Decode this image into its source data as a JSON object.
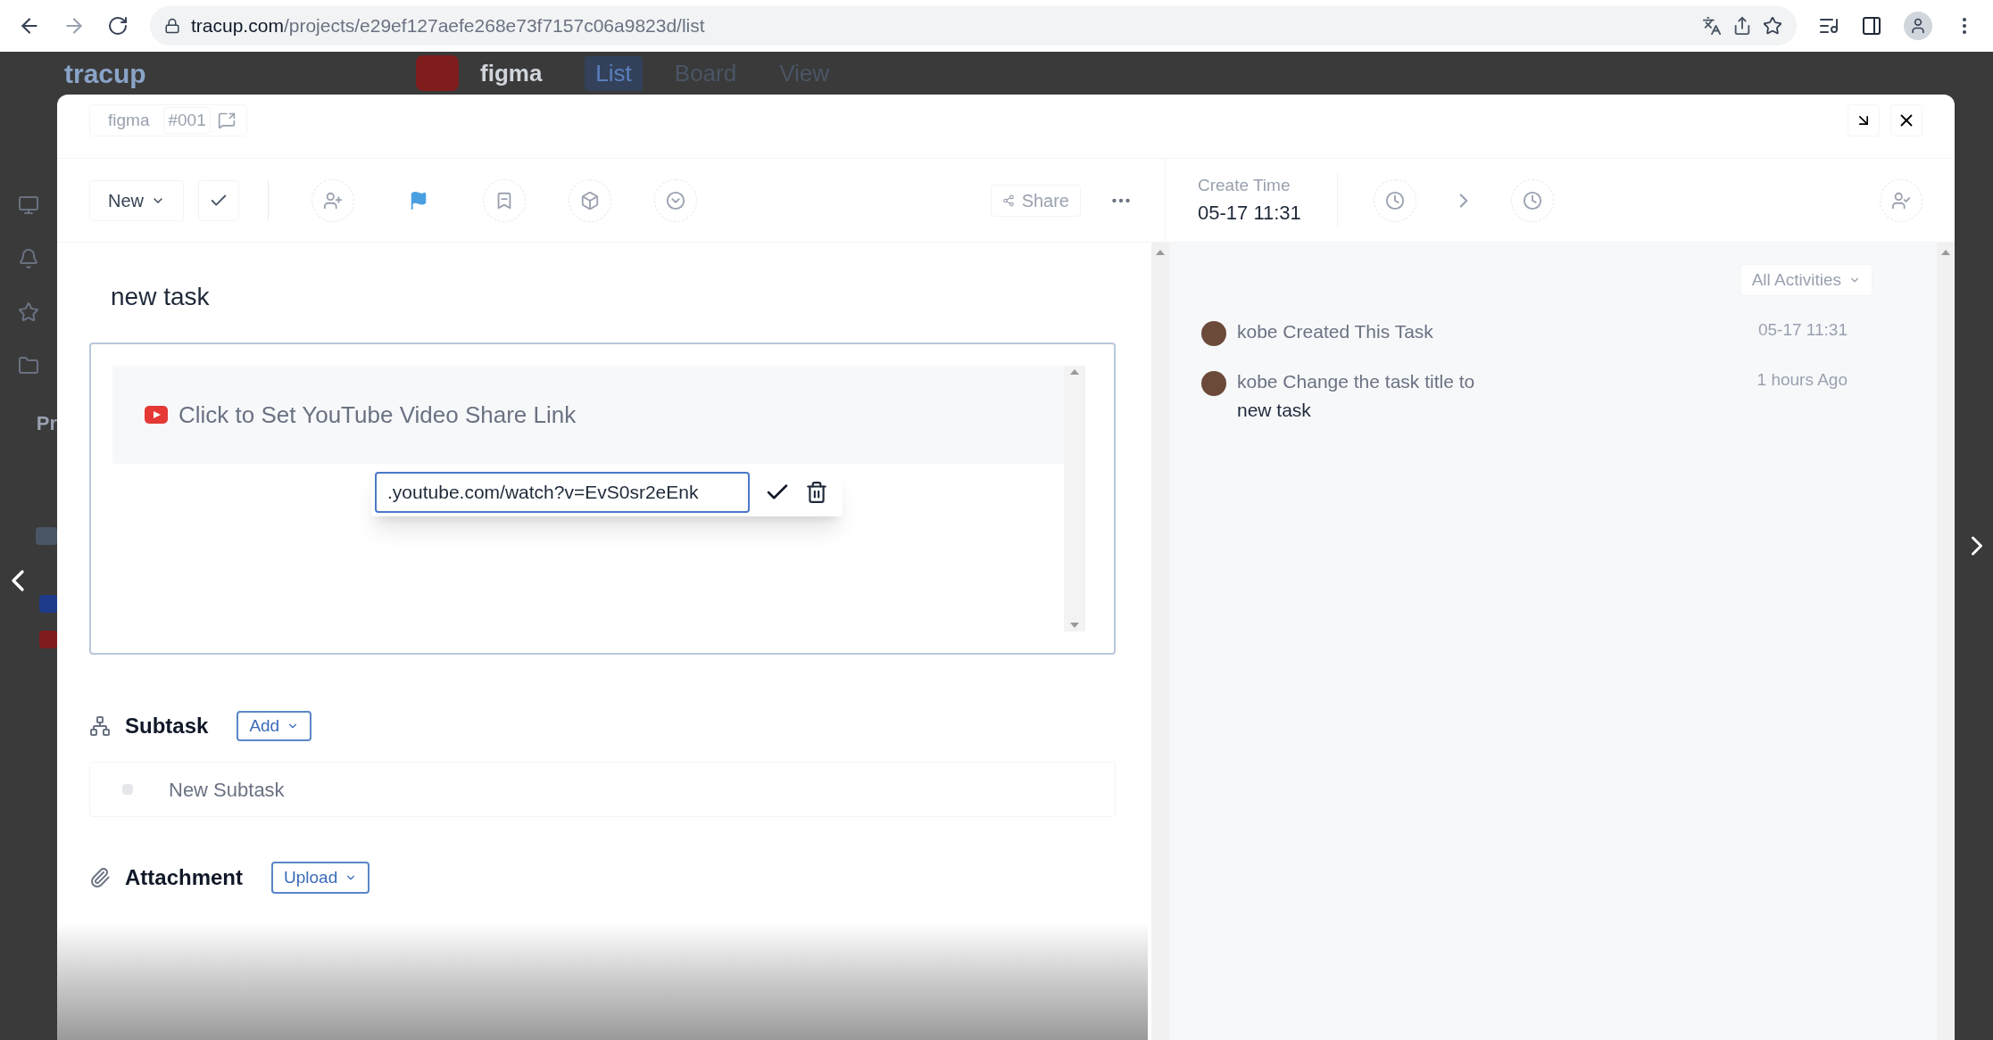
{
  "browser": {
    "url_host": "tracup.com",
    "url_path": "/projects/e29ef127aefe268e73f7157c06a9823d/list"
  },
  "app": {
    "logo": "tracup",
    "project": "figma",
    "views": [
      {
        "label": "List",
        "selected": true
      },
      {
        "label": "Board",
        "selected": false
      },
      {
        "label": "View",
        "selected": false
      }
    ]
  },
  "sidebar": {
    "section_text": "Pr"
  },
  "modal": {
    "tags": [
      "figma",
      "#001"
    ],
    "status": "New",
    "share": "Share",
    "create_time": {
      "label": "Create Time",
      "value": "05-17 11:31"
    },
    "title": "new task",
    "video_prompt": "Click to Set YouTube Video Share Link",
    "link_input": {
      "value": ".youtube.com/watch?v=EvS0sr2eEnk"
    },
    "subtask": {
      "heading": "Subtask",
      "add_button": "Add",
      "items": [
        {
          "placeholder": "New Subtask"
        }
      ]
    },
    "attachment": {
      "heading": "Attachment",
      "upload_button": "Upload"
    },
    "activities": {
      "filter": "All Activities",
      "items": [
        {
          "text": "kobe Created This Task",
          "time": "05-17 11:31"
        },
        {
          "text": "kobe Change the task title to",
          "detail": "new task",
          "time": "1 hours Ago"
        }
      ]
    }
  }
}
